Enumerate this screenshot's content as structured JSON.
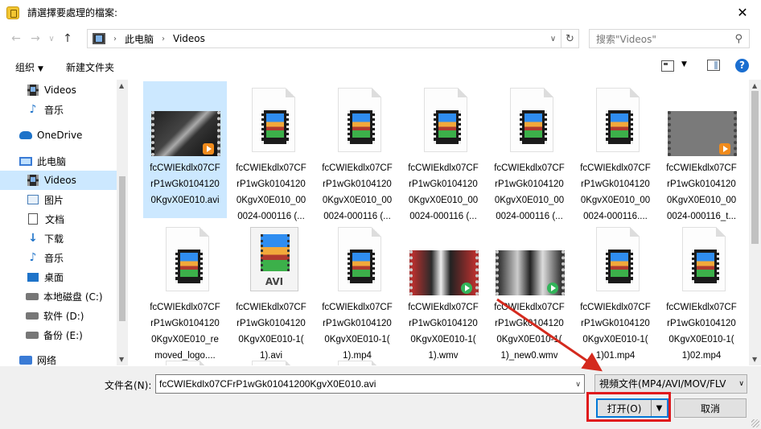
{
  "window": {
    "title": "請選擇要處理的檔案:",
    "close_glyph": "✕"
  },
  "nav": {
    "back_glyph": "←",
    "forward_glyph": "→",
    "recent_glyph": "∨",
    "up_glyph": "↑",
    "breadcrumb": [
      "此电脑",
      "Videos"
    ],
    "breadcrumb_sep": "›",
    "dropdown_glyph": "∨",
    "refresh_glyph": "↻",
    "search_placeholder": "搜索\"Videos\"",
    "search_glyph": "⚲"
  },
  "toolbar": {
    "organize": "组织",
    "organize_caret": "▼",
    "new_folder": "新建文件夹",
    "view_caret": "▼",
    "help": "?"
  },
  "sidebar": {
    "items": [
      {
        "label": "Videos",
        "icon": "video-folder-icon"
      },
      {
        "label": "音乐",
        "icon": "music-icon"
      },
      {
        "label": "OneDrive",
        "icon": "onedrive-icon"
      },
      {
        "label": "此电脑",
        "icon": "this-pc-icon"
      },
      {
        "label": "Videos",
        "icon": "video-folder-icon",
        "selected": true
      },
      {
        "label": "图片",
        "icon": "pictures-icon"
      },
      {
        "label": "文档",
        "icon": "documents-icon"
      },
      {
        "label": "下载",
        "icon": "downloads-icon"
      },
      {
        "label": "音乐",
        "icon": "music-icon"
      },
      {
        "label": "桌面",
        "icon": "desktop-icon"
      },
      {
        "label": "本地磁盘 (C:)",
        "icon": "drive-icon"
      },
      {
        "label": "软件 (D:)",
        "icon": "drive-icon"
      },
      {
        "label": "备份 (E:)",
        "icon": "drive-icon"
      },
      {
        "label": "网络",
        "icon": "network-icon"
      }
    ],
    "music_glyph": "♪",
    "down_glyph": "↓"
  },
  "files": [
    {
      "name": "fcCWIEkdlx07CFrP1wGk01041200KgvX0E010.avi",
      "lines": [
        "fcCWIEkdlx07CF",
        "rP1wGk0104120",
        "0KgvX0E010.avi"
      ],
      "thumb": "video-joker",
      "selected": true
    },
    {
      "name": "fcCWIEkdlx07CFrP1wGk01041200KgvX0E010_00024-000116 (",
      "lines": [
        "fcCWIEkdlx07CF",
        "rP1wGk0104120",
        "0KgvX0E010_00",
        "0024-000116 (..."
      ],
      "thumb": "generic-video"
    },
    {
      "name": "fcCWIEkdlx07CFrP1wGk01041200KgvX0E010_00024-000116 (",
      "lines": [
        "fcCWIEkdlx07CF",
        "rP1wGk0104120",
        "0KgvX0E010_00",
        "0024-000116 (..."
      ],
      "thumb": "generic-video"
    },
    {
      "name": "fcCWIEkdlx07CFrP1wGk01041200KgvX0E010_00024-000116 (",
      "lines": [
        "fcCWIEkdlx07CF",
        "rP1wGk0104120",
        "0KgvX0E010_00",
        "0024-000116 (..."
      ],
      "thumb": "generic-video"
    },
    {
      "name": "fcCWIEkdlx07CFrP1wGk01041200KgvX0E010_00024-000116 (",
      "lines": [
        "fcCWIEkdlx07CF",
        "rP1wGk0104120",
        "0KgvX0E010_00",
        "0024-000116 (..."
      ],
      "thumb": "generic-video"
    },
    {
      "name": "fcCWIEkdlx07CFrP1wGk01041200KgvX0E010_00024-000116",
      "lines": [
        "fcCWIEkdlx07CF",
        "rP1wGk0104120",
        "0KgvX0E010_00",
        "0024-000116...."
      ],
      "thumb": "generic-video"
    },
    {
      "name": "fcCWIEkdlx07CFrP1wGk01041200KgvX0E010_00024-000116_t",
      "lines": [
        "fcCWIEkdlx07CF",
        "rP1wGk0104120",
        "0KgvX0E010_00",
        "0024-000116_t..."
      ],
      "thumb": "video-grey"
    },
    {
      "name": "fcCWIEkdlx07CFrP1wGk01041200KgvX0E010_removed_logo",
      "lines": [
        "fcCWIEkdlx07CF",
        "rP1wGk0104120",
        "0KgvX0E010_re",
        "moved_logo...."
      ],
      "thumb": "generic-video"
    },
    {
      "name": "fcCWIEkdlx07CFrP1wGk01041200KgvX0E010-1(1).avi",
      "lines": [
        "fcCWIEkdlx07CF",
        "rP1wGk0104120",
        "0KgvX0E010-1(",
        "1).avi"
      ],
      "thumb": "avi-file",
      "avi_label": "AVI"
    },
    {
      "name": "fcCWIEkdlx07CFrP1wGk01041200KgvX0E010-1(1).mp4",
      "lines": [
        "fcCWIEkdlx07CF",
        "rP1wGk0104120",
        "0KgvX0E010-1(",
        "1).mp4"
      ],
      "thumb": "generic-video"
    },
    {
      "name": "fcCWIEkdlx07CFrP1wGk01041200KgvX0E010-1(1).wmv",
      "lines": [
        "fcCWIEkdlx07CF",
        "rP1wGk0104120",
        "0KgvX0E010-1(",
        "1).wmv"
      ],
      "thumb": "video-joker2"
    },
    {
      "name": "fcCWIEkdlx07CFrP1wGk01041200KgvX0E010-1(1)_new0.wmv",
      "lines": [
        "fcCWIEkdlx07CF",
        "rP1wGk0104120",
        "0KgvX0E010-1(",
        "1)_new0.wmv"
      ],
      "thumb": "video-joker3"
    },
    {
      "name": "fcCWIEkdlx07CFrP1wGk01041200KgvX0E010-1(1)01.mp4",
      "lines": [
        "fcCWIEkdlx07CF",
        "rP1wGk0104120",
        "0KgvX0E010-1(",
        "1)01.mp4"
      ],
      "thumb": "generic-video"
    },
    {
      "name": "fcCWIEkdlx07CFrP1wGk01041200KgvX0E010-1(1)02.mp4",
      "lines": [
        "fcCWIEkdlx07CF",
        "rP1wGk0104120",
        "0KgvX0E010-1(",
        "1)02.mp4"
      ],
      "thumb": "generic-video"
    }
  ],
  "footer": {
    "filename_label": "文件名(N):",
    "filename_value": "fcCWIEkdlx07CFrP1wGk01041200KgvX0E010.avi",
    "filetype_value": "視頻文件(MP4/AVI/MOV/FLV",
    "dropdown_glyph": "∨",
    "open_label": "打开(O)",
    "open_split_glyph": "▼",
    "cancel_label": "取消"
  },
  "scroll": {
    "up": "▲",
    "down": "▼"
  },
  "colors": {
    "selection": "#cce8ff",
    "accent": "#0078d7",
    "highlight_box": "#e0191c",
    "arrow": "#d42a1e"
  }
}
